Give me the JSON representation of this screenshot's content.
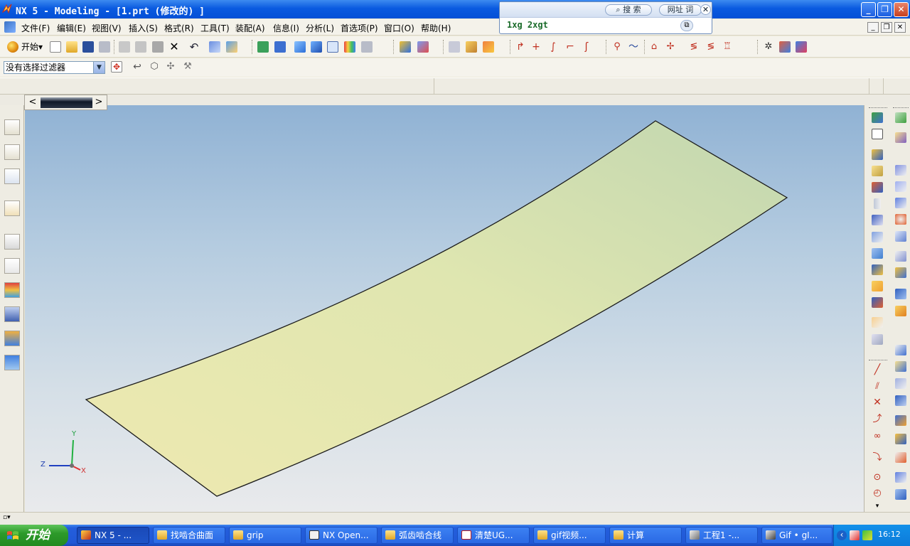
{
  "window": {
    "title": "NX 5 - Modeling - [1.prt (修改的) ]",
    "minimize": "_",
    "maximize": "❐",
    "close": "✕"
  },
  "search_widget": {
    "search_label": "搜 索",
    "url_label": "网址 词",
    "close_label": "✕",
    "input_value": "1xg 2xgt",
    "copy_label": "⧉"
  },
  "menu": {
    "items": [
      "文件(F)",
      "编辑(E)",
      "视图(V)",
      "插入(S)",
      "格式(R)",
      "工具(T)",
      "装配(A)",
      "信息(I)",
      "分析(L)",
      "首选项(P)",
      "窗口(O)",
      "帮助(H)"
    ],
    "mdi_minimize": "_",
    "mdi_restore": "❐",
    "mdi_close": "✕"
  },
  "toolbar": {
    "start_label": "开始",
    "start_dropdown": "▾",
    "filter_value": "没有选择过滤器",
    "filter_arrow": "▼"
  },
  "tabs": {
    "prev": "<",
    "next": ">"
  },
  "axes": {
    "x": "X",
    "y": "Y",
    "z": "Z"
  },
  "statusbar": {
    "indicator": "▫▾"
  },
  "taskbar": {
    "start_label": "开始",
    "tasks": [
      "NX 5 - ...",
      "找啮合曲面",
      "grip",
      "NX Open...",
      "弧齿啮合线",
      "清楚UG...",
      "gif视频...",
      "计算",
      "工程1 -...",
      "Gif • gI..."
    ],
    "clock": "16:12",
    "tray_arrow": "‹"
  },
  "colors": {
    "title_bar": "#0a5ae0",
    "surface_fill": "#dfe6b0",
    "viewport_top": "#90b2d4",
    "viewport_bottom": "#e9eaec",
    "taskbar": "#245edc",
    "start_button": "#2d9a2a"
  }
}
